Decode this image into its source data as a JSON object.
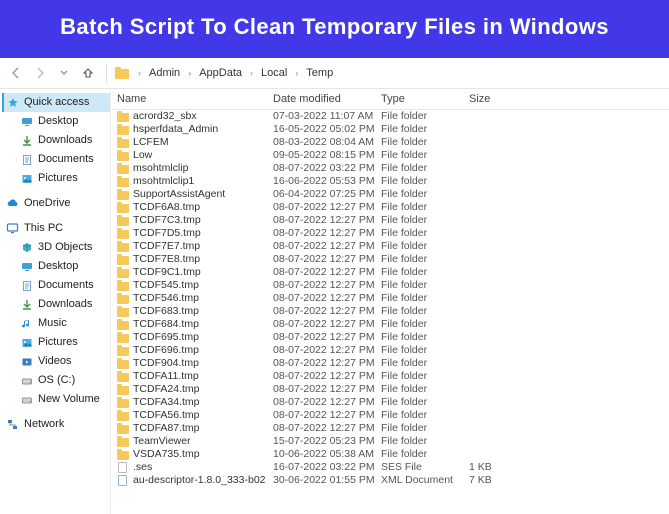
{
  "banner": {
    "title": "Batch Script To Clean Temporary Files in Windows"
  },
  "breadcrumb": {
    "segments": [
      "Admin",
      "AppData",
      "Local",
      "Temp"
    ]
  },
  "columns": {
    "name": "Name",
    "date": "Date modified",
    "type": "Type",
    "size": "Size"
  },
  "sidebar": {
    "quick_access": {
      "label": "Quick access",
      "items": [
        {
          "label": "Desktop",
          "icon": "desktop"
        },
        {
          "label": "Downloads",
          "icon": "downloads"
        },
        {
          "label": "Documents",
          "icon": "documents"
        },
        {
          "label": "Pictures",
          "icon": "pictures"
        }
      ]
    },
    "onedrive": {
      "label": "OneDrive"
    },
    "this_pc": {
      "label": "This PC",
      "items": [
        {
          "label": "3D Objects",
          "icon": "objects3d"
        },
        {
          "label": "Desktop",
          "icon": "desktop"
        },
        {
          "label": "Documents",
          "icon": "documents"
        },
        {
          "label": "Downloads",
          "icon": "downloads"
        },
        {
          "label": "Music",
          "icon": "music"
        },
        {
          "label": "Pictures",
          "icon": "pictures"
        },
        {
          "label": "Videos",
          "icon": "videos"
        },
        {
          "label": "OS (C:)",
          "icon": "disk"
        },
        {
          "label": "New Volume",
          "icon": "disk"
        }
      ]
    },
    "network": {
      "label": "Network"
    }
  },
  "rows": [
    {
      "name": "acrord32_sbx",
      "date": "07-03-2022 11:07 AM",
      "type": "File folder",
      "size": "",
      "kind": "folder"
    },
    {
      "name": "hsperfdata_Admin",
      "date": "16-05-2022 05:02 PM",
      "type": "File folder",
      "size": "",
      "kind": "folder"
    },
    {
      "name": "LCFEM",
      "date": "08-03-2022 08:04 AM",
      "type": "File folder",
      "size": "",
      "kind": "folder"
    },
    {
      "name": "Low",
      "date": "09-05-2022 08:15 PM",
      "type": "File folder",
      "size": "",
      "kind": "folder"
    },
    {
      "name": "msohtmlclip",
      "date": "08-07-2022 03:22 PM",
      "type": "File folder",
      "size": "",
      "kind": "folder"
    },
    {
      "name": "msohtmlclip1",
      "date": "16-06-2022 05:53 PM",
      "type": "File folder",
      "size": "",
      "kind": "folder"
    },
    {
      "name": "SupportAssistAgent",
      "date": "06-04-2022 07:25 PM",
      "type": "File folder",
      "size": "",
      "kind": "folder"
    },
    {
      "name": "TCDF6A8.tmp",
      "date": "08-07-2022 12:27 PM",
      "type": "File folder",
      "size": "",
      "kind": "folder"
    },
    {
      "name": "TCDF7C3.tmp",
      "date": "08-07-2022 12:27 PM",
      "type": "File folder",
      "size": "",
      "kind": "folder"
    },
    {
      "name": "TCDF7D5.tmp",
      "date": "08-07-2022 12:27 PM",
      "type": "File folder",
      "size": "",
      "kind": "folder"
    },
    {
      "name": "TCDF7E7.tmp",
      "date": "08-07-2022 12:27 PM",
      "type": "File folder",
      "size": "",
      "kind": "folder"
    },
    {
      "name": "TCDF7E8.tmp",
      "date": "08-07-2022 12:27 PM",
      "type": "File folder",
      "size": "",
      "kind": "folder"
    },
    {
      "name": "TCDF9C1.tmp",
      "date": "08-07-2022 12:27 PM",
      "type": "File folder",
      "size": "",
      "kind": "folder"
    },
    {
      "name": "TCDF545.tmp",
      "date": "08-07-2022 12:27 PM",
      "type": "File folder",
      "size": "",
      "kind": "folder"
    },
    {
      "name": "TCDF546.tmp",
      "date": "08-07-2022 12:27 PM",
      "type": "File folder",
      "size": "",
      "kind": "folder"
    },
    {
      "name": "TCDF683.tmp",
      "date": "08-07-2022 12:27 PM",
      "type": "File folder",
      "size": "",
      "kind": "folder"
    },
    {
      "name": "TCDF684.tmp",
      "date": "08-07-2022 12:27 PM",
      "type": "File folder",
      "size": "",
      "kind": "folder"
    },
    {
      "name": "TCDF695.tmp",
      "date": "08-07-2022 12:27 PM",
      "type": "File folder",
      "size": "",
      "kind": "folder"
    },
    {
      "name": "TCDF696.tmp",
      "date": "08-07-2022 12:27 PM",
      "type": "File folder",
      "size": "",
      "kind": "folder"
    },
    {
      "name": "TCDF904.tmp",
      "date": "08-07-2022 12:27 PM",
      "type": "File folder",
      "size": "",
      "kind": "folder"
    },
    {
      "name": "TCDFA11.tmp",
      "date": "08-07-2022 12:27 PM",
      "type": "File folder",
      "size": "",
      "kind": "folder"
    },
    {
      "name": "TCDFA24.tmp",
      "date": "08-07-2022 12:27 PM",
      "type": "File folder",
      "size": "",
      "kind": "folder"
    },
    {
      "name": "TCDFA34.tmp",
      "date": "08-07-2022 12:27 PM",
      "type": "File folder",
      "size": "",
      "kind": "folder"
    },
    {
      "name": "TCDFA56.tmp",
      "date": "08-07-2022 12:27 PM",
      "type": "File folder",
      "size": "",
      "kind": "folder"
    },
    {
      "name": "TCDFA87.tmp",
      "date": "08-07-2022 12:27 PM",
      "type": "File folder",
      "size": "",
      "kind": "folder"
    },
    {
      "name": "TeamViewer",
      "date": "15-07-2022 05:23 PM",
      "type": "File folder",
      "size": "",
      "kind": "folder"
    },
    {
      "name": "VSDA735.tmp",
      "date": "10-06-2022 05:38 AM",
      "type": "File folder",
      "size": "",
      "kind": "folder"
    },
    {
      "name": ".ses",
      "date": "16-07-2022 03:22 PM",
      "type": "SES File",
      "size": "1 KB",
      "kind": "file"
    },
    {
      "name": "au-descriptor-1.8.0_333-b02",
      "date": "30-06-2022 01:55 PM",
      "type": "XML Document",
      "size": "7 KB",
      "kind": "xml"
    }
  ]
}
